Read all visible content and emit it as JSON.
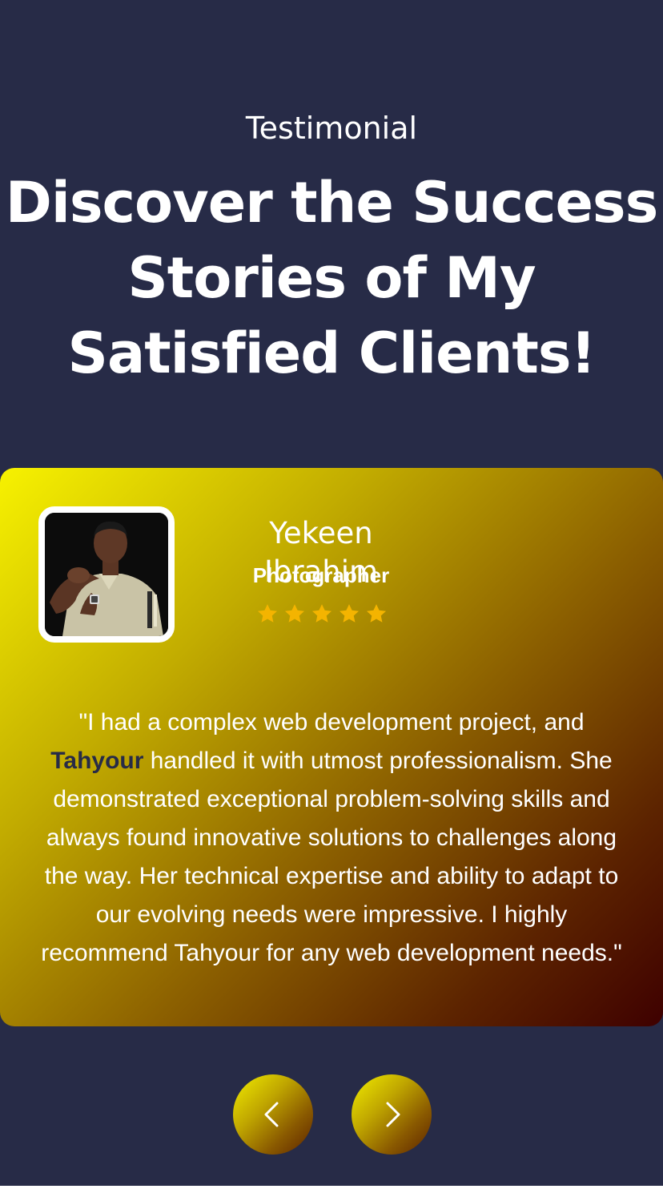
{
  "section": {
    "eyebrow": "Testimonial",
    "headline_lines": [
      "Discover the Success",
      "Stories of My",
      "Satisfied Clients!"
    ]
  },
  "testimonial": {
    "name": "Yekeen Ibrahim",
    "role": "Photographer",
    "rating": 5,
    "rating_max": 5,
    "quote_before": "\"I had a complex web development project, and ",
    "quote_highlight": "Tahyour",
    "quote_after": " handled it with utmost professionalism. She demonstrated exceptional problem-solving skills and always found innovative solutions to challenges along the way. Her technical expertise and ability to adapt to our evolving needs were impressive. I highly recommend Tahyour for any web development needs.\""
  },
  "navigation": {
    "prev_icon": "chevron-left-icon",
    "next_icon": "chevron-right-icon"
  },
  "colors": {
    "background": "#272b47",
    "text": "#ffffff",
    "highlight": "#272b47",
    "star": "#f4b400",
    "card_gradient_start": "#f7f200",
    "card_gradient_end": "#3e0000"
  }
}
